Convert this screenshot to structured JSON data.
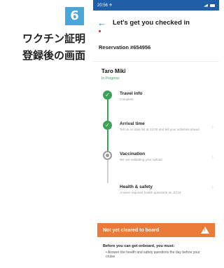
{
  "annotation": {
    "step_number": "6",
    "line1": "ワクチン証明",
    "line2": "登録後の画面"
  },
  "statusbar": {
    "time": "20:56 ✈",
    "right": "..ll ▼ ■"
  },
  "header": {
    "back_icon": "←",
    "title": "Let's get you checked in"
  },
  "reservation": {
    "label": "Reservation #654956"
  },
  "passenger": {
    "name": "Taro  Miki",
    "sub": "In Progress"
  },
  "steps": [
    {
      "title": "Travel info",
      "desc": "Complete",
      "status": "done"
    },
    {
      "title": "Arrival time",
      "desc": "Tell us on date list at 12:00 and tell your activities ahead",
      "status": "done"
    },
    {
      "title": "Vaccination",
      "desc": "We are validating your upload",
      "status": "pending"
    },
    {
      "title": "Health & safety",
      "desc": "Answer required health questions on Jul 01",
      "status": "none"
    }
  ],
  "banner": {
    "text": "Not yet cleared to board",
    "icon": "warning-icon"
  },
  "instructions": {
    "heading": "Before you can get onboard, you must:",
    "bullet1": "• Answer the health and safety questions the day before your cruise"
  },
  "colors": {
    "accent": "#2e7bd6",
    "status_bar": "#1f5fa8",
    "done_green": "#3aa357",
    "banner_orange": "#ea7a37",
    "step_badge": "#4aa5d8"
  }
}
